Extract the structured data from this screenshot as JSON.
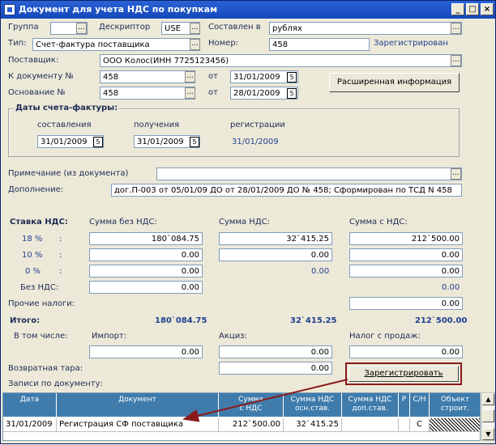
{
  "window": {
    "title": "Документ для учета НДС по покупкам"
  },
  "header": {
    "group_label": "Группа",
    "group_value": "",
    "descriptor_label": "Дескриптор",
    "descriptor_value": "USE",
    "composed_label": "Составлен в",
    "composed_value": "рублях",
    "type_label": "Тип:",
    "type_value": "Счет-фактура поставщика",
    "number_label": "Номер:",
    "number_value": "458",
    "status": "Зарегистрирован",
    "supplier_label": "Поставщик:",
    "supplier_value": "ООО Колос(ИНН 7725123456)",
    "todoc_label": "К документу №",
    "todoc_value": "458",
    "todoc_from_label": "от",
    "todoc_date": "31/01/2009",
    "basis_label": "Основание №",
    "basis_value": "458",
    "basis_from_label": "от",
    "basis_date": "28/01/2009",
    "ext_info_label": "Расширенная информация"
  },
  "invoice_dates": {
    "title": "Даты счета-фактуры:",
    "composed_label": "составления",
    "composed_date": "31/01/2009",
    "received_label": "получения",
    "received_date": "31/01/2009",
    "registered_label": "регистрации",
    "registered_date": "31/01/2009"
  },
  "notes": {
    "note_label": "Примечание (из документа)",
    "note_value": "",
    "addition_label": "Дополнение:",
    "addition_value": "дог.П-003 от 05/01/09 ДО от 28/01/2009 ДО № 458; Сформирован по ТСД N 458"
  },
  "vat": {
    "rate_label": "Ставка НДС:",
    "col_without": "Сумма без НДС:",
    "col_vat": "Сумма НДС:",
    "col_with": "Сумма с НДС:",
    "rows": [
      {
        "label": "18 %",
        "colon": ":",
        "without": "180`084.75",
        "vat": "32`415.25",
        "with": "212`500.00"
      },
      {
        "label": "10 %",
        "colon": ":",
        "without": "0.00",
        "vat": "0.00",
        "with": "0.00"
      },
      {
        "label": "0 %",
        "colon": ":",
        "without": "0.00",
        "vat": "0.00",
        "with": "0.00"
      },
      {
        "label": "Без НДС:",
        "colon": "",
        "without": "0.00",
        "vat": "",
        "with": "0.00"
      }
    ],
    "other_taxes_label": "Прочие налоги:",
    "other_taxes_value": "0.00",
    "total_label": "Итого:",
    "total_without": "180`084.75",
    "total_vat": "32`415.25",
    "total_with": "212`500.00",
    "including_label": "В том числе:",
    "import_label": "Импорт:",
    "import_value": "0.00",
    "excise_label": "Акциз:",
    "excise_value": "0.00",
    "sales_tax_label": "Налог с продаж:",
    "sales_tax_value": "0.00",
    "returnable_label": "Возвратная тара:",
    "returnable_value": "0.00",
    "register_button": "Зарегистрировать",
    "records_label": "Записи по документу:"
  },
  "table": {
    "headers": [
      "Дата",
      "Документ",
      "Сумма\nс НДС",
      "Сумма НДС\nосн.став.",
      "Сумма НДС\nдоп.став.",
      "Р",
      "С/Н",
      "Объект\nстроит."
    ],
    "rows": [
      [
        "31/01/2009",
        "Регистрация СФ поставщика",
        "212`500.00",
        "32`415.25",
        "",
        "",
        "С",
        ""
      ]
    ]
  },
  "colors": {
    "title_bar": "#2a62d6",
    "header_bg": "#3f7cac",
    "arrow": "#8b1a1a"
  }
}
